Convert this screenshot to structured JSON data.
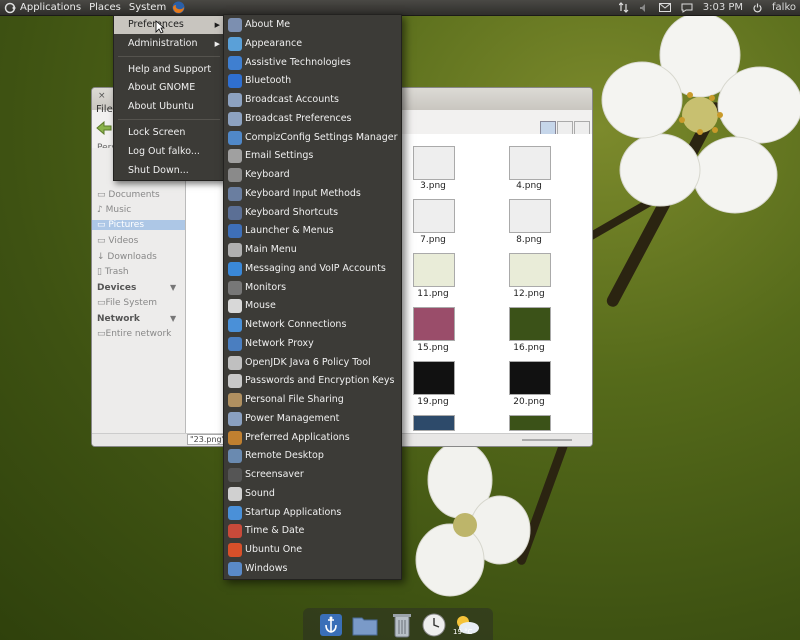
{
  "top_panel": {
    "menus": [
      "Applications",
      "Places",
      "System"
    ],
    "clock": "3:03 PM",
    "user": "falko",
    "icons": {
      "network": "network-updown-icon",
      "volume": "speaker-icon",
      "mail": "envelope-icon",
      "chat": "chat-bubble-icon",
      "user": "power-icon"
    }
  },
  "system_menu": {
    "items": [
      {
        "label": "Preferences",
        "submenu": true,
        "highlighted": true
      },
      {
        "label": "Administration",
        "submenu": true
      },
      {
        "label": "Help and Support"
      },
      {
        "label": "About GNOME"
      },
      {
        "label": "About Ubuntu"
      },
      {
        "label": "Lock Screen"
      },
      {
        "label": "Log Out falko..."
      },
      {
        "label": "Shut Down..."
      }
    ]
  },
  "preferences_menu": {
    "items": [
      {
        "label": "About Me",
        "icon": "person-icon",
        "color": "#7c8fb0"
      },
      {
        "label": "Appearance",
        "icon": "paint-icon",
        "color": "#5aa0d8"
      },
      {
        "label": "Assistive Technologies",
        "icon": "accessibility-icon",
        "color": "#3f7fd0"
      },
      {
        "label": "Bluetooth",
        "icon": "bluetooth-icon",
        "color": "#2f6fd0"
      },
      {
        "label": "Broadcast Accounts",
        "icon": "broadcast-icon",
        "color": "#8da2c0"
      },
      {
        "label": "Broadcast Preferences",
        "icon": "broadcast-icon",
        "color": "#8da2c0"
      },
      {
        "label": "CompizConfig Settings Manager",
        "icon": "compiz-icon",
        "color": "#5088c8"
      },
      {
        "label": "Email Settings",
        "icon": "email-icon",
        "color": "#a0a0a0"
      },
      {
        "label": "Keyboard",
        "icon": "keyboard-icon",
        "color": "#8a8a8a"
      },
      {
        "label": "Keyboard Input Methods",
        "icon": "keyboard-icon",
        "color": "#6a7ea0"
      },
      {
        "label": "Keyboard Shortcuts",
        "icon": "keyboard-icon",
        "color": "#5b6f95"
      },
      {
        "label": "Launcher & Menus",
        "icon": "launcher-icon",
        "color": "#3e6fb8"
      },
      {
        "label": "Main Menu",
        "icon": "menu-icon",
        "color": "#b0b0b0"
      },
      {
        "label": "Messaging and VoIP Accounts",
        "icon": "chat-icon",
        "color": "#3a88d8"
      },
      {
        "label": "Monitors",
        "icon": "monitor-icon",
        "color": "#777777"
      },
      {
        "label": "Mouse",
        "icon": "mouse-icon",
        "color": "#d8d8d8"
      },
      {
        "label": "Network Connections",
        "icon": "network-icon",
        "color": "#4a90d8"
      },
      {
        "label": "Network Proxy",
        "icon": "network-icon",
        "color": "#4a7ec0"
      },
      {
        "label": "OpenJDK Java 6 Policy Tool",
        "icon": "java-icon",
        "color": "#c0c0c0"
      },
      {
        "label": "Passwords and Encryption Keys",
        "icon": "key-icon",
        "color": "#c8c8c8"
      },
      {
        "label": "Personal File Sharing",
        "icon": "folder-share-icon",
        "color": "#b09060"
      },
      {
        "label": "Power Management",
        "icon": "battery-icon",
        "color": "#8aa0c0"
      },
      {
        "label": "Preferred Applications",
        "icon": "apps-icon",
        "color": "#c08030"
      },
      {
        "label": "Remote Desktop",
        "icon": "remote-icon",
        "color": "#6a8ab0"
      },
      {
        "label": "Screensaver",
        "icon": "screensaver-icon",
        "color": "#555555"
      },
      {
        "label": "Sound",
        "icon": "sound-icon",
        "color": "#d0d0d0"
      },
      {
        "label": "Startup Applications",
        "icon": "startup-icon",
        "color": "#4a90d8"
      },
      {
        "label": "Time & Date",
        "icon": "calendar-icon",
        "color": "#c84a3a"
      },
      {
        "label": "Ubuntu One",
        "icon": "ubuntu-one-icon",
        "color": "#d8502a"
      },
      {
        "label": "Windows",
        "icon": "windows-icon",
        "color": "#5a8ac8"
      }
    ]
  },
  "file_manager": {
    "title_fragment": "File",
    "places_fragment": "Pers",
    "sidebar": [
      {
        "label": "Documents",
        "icon": "folder-icon"
      },
      {
        "label": "Music",
        "icon": "music-icon"
      },
      {
        "label": "Pictures",
        "icon": "folder-icon",
        "selected": true
      },
      {
        "label": "Videos",
        "icon": "film-icon"
      },
      {
        "label": "Downloads",
        "icon": "download-icon"
      },
      {
        "label": "Trash",
        "icon": "trash-icon"
      }
    ],
    "devices_header": "Devices",
    "devices": [
      {
        "label": "File System",
        "icon": "drive-icon"
      }
    ],
    "network_header": "Network",
    "network": [
      {
        "label": "Entire network",
        "icon": "network-icon"
      }
    ],
    "files": [
      "3.png",
      "4.png",
      "7.png",
      "8.png",
      "11.png",
      "12.png",
      "15.png",
      "16.png",
      "19.png",
      "20.png"
    ],
    "status": "\"23.png\" s"
  },
  "dock": {
    "weather_temp": "19 °C",
    "items": [
      "anchor-icon",
      "folder-icon",
      "trash-icon",
      "clock-icon",
      "weather-icon"
    ]
  }
}
